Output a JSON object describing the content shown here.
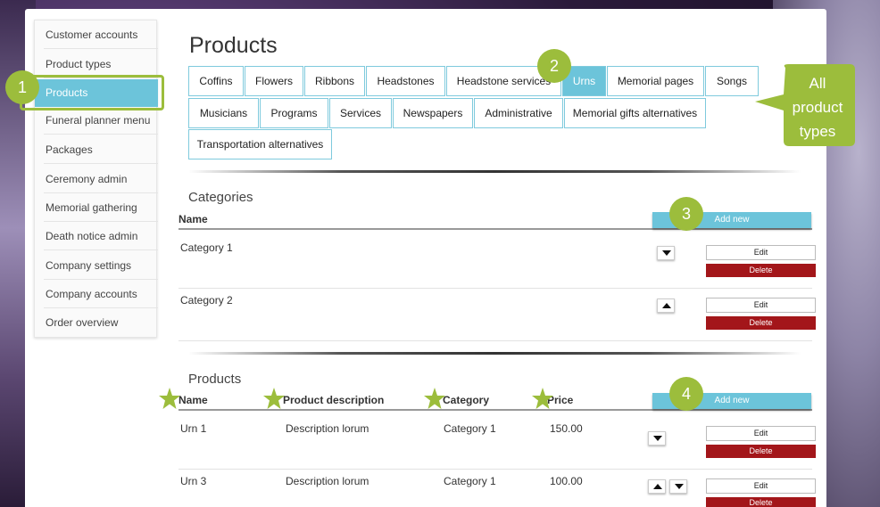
{
  "sidebar": {
    "items": [
      {
        "label": "Customer accounts"
      },
      {
        "label": "Product types"
      },
      {
        "label": "Products"
      },
      {
        "label": "Funeral planner menu"
      },
      {
        "label": "Packages"
      },
      {
        "label": "Ceremony admin"
      },
      {
        "label": "Memorial gathering"
      },
      {
        "label": "Death notice admin"
      },
      {
        "label": "Company settings"
      },
      {
        "label": "Company accounts"
      },
      {
        "label": "Order overview"
      }
    ],
    "active": "Products"
  },
  "page_title": "Products",
  "tabs": [
    {
      "label": "Coffins"
    },
    {
      "label": "Flowers"
    },
    {
      "label": "Ribbons"
    },
    {
      "label": "Headstones"
    },
    {
      "label": "Headstone services"
    },
    {
      "label": "Urns"
    },
    {
      "label": "Memorial pages"
    },
    {
      "label": "Songs"
    },
    {
      "label": "Musicians"
    },
    {
      "label": "Programs"
    },
    {
      "label": "Services"
    },
    {
      "label": "Newspapers"
    },
    {
      "label": "Administrative"
    },
    {
      "label": "Memorial gifts alternatives"
    },
    {
      "label": "Transportation alternatives"
    }
  ],
  "active_tab": "Urns",
  "categories": {
    "title": "Categories",
    "header_name": "Name",
    "add_label": "Add new",
    "rows": [
      {
        "name": "Category 1",
        "edit": "Edit",
        "delete": "Delete"
      },
      {
        "name": "Category 2",
        "edit": "Edit",
        "delete": "Delete"
      }
    ]
  },
  "products": {
    "title": "Products",
    "headers": {
      "name": "Name",
      "description": "Product description",
      "category": "Category",
      "price": "Price"
    },
    "add_label": "Add new",
    "rows": [
      {
        "name": "Urn 1",
        "description": "Description lorum",
        "category": "Category 1",
        "price": "150.00",
        "edit": "Edit",
        "delete": "Delete"
      },
      {
        "name": "Urn 3",
        "description": "Description lorum",
        "category": "Category 1",
        "price": "100.00",
        "edit": "Edit",
        "delete": "Delete"
      }
    ]
  },
  "annotations": {
    "step1": "1",
    "step2": "2",
    "step3": "3",
    "step4": "4",
    "callout_line1": "All",
    "callout_line2": "product",
    "callout_line3": "types",
    "accent_color": "#9cbd3c"
  },
  "colors": {
    "active_blue": "#6cc4da",
    "delete_red": "#a3161a",
    "tab_border": "#7fcadd"
  },
  "icons": {
    "down_arrow": "caret-down-icon",
    "up_arrow": "caret-up-icon",
    "star": "star-icon"
  }
}
